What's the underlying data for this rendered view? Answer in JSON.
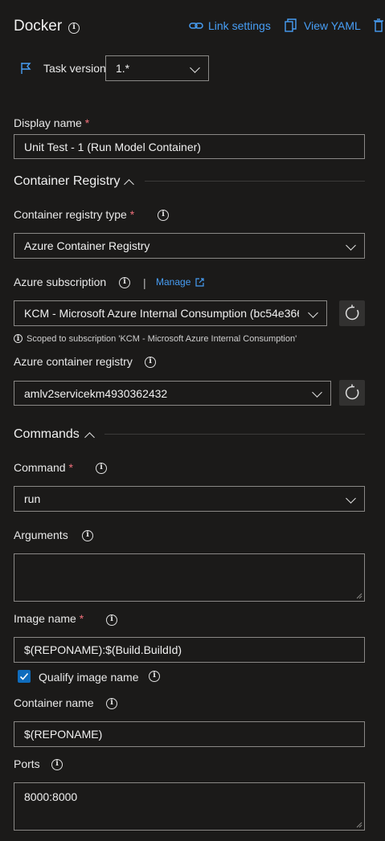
{
  "header": {
    "title": "Docker",
    "link_settings": "Link settings",
    "view_yaml": "View YAML"
  },
  "task_version": {
    "label": "Task version",
    "value": "1.*"
  },
  "display_name": {
    "label": "Display name",
    "required": "*",
    "value": "Unit Test - 1 (Run Model Container)"
  },
  "container_registry_section": {
    "title": "Container Registry"
  },
  "registry_type": {
    "label": "Container registry type",
    "required": "*",
    "value": "Azure Container Registry"
  },
  "azure_subscription": {
    "label": "Azure subscription",
    "separator": "|",
    "manage": "Manage",
    "value": "KCM - Microsoft Azure Internal Consumption (bc54e366",
    "note": "Scoped to subscription 'KCM - Microsoft Azure Internal Consumption'"
  },
  "azure_container_registry": {
    "label": "Azure container registry",
    "value": "amlv2servicekm4930362432"
  },
  "commands_section": {
    "title": "Commands"
  },
  "command": {
    "label": "Command",
    "required": "*",
    "value": "run"
  },
  "arguments": {
    "label": "Arguments",
    "value": ""
  },
  "image_name": {
    "label": "Image name",
    "required": "*",
    "value": "$(REPONAME):$(Build.BuildId)"
  },
  "qualify_image_name": {
    "label": "Qualify image name",
    "checked": true
  },
  "container_name": {
    "label": "Container name",
    "value": "$(REPONAME)"
  },
  "ports": {
    "label": "Ports",
    "value": "8000:8000"
  },
  "colors": {
    "accent": "#479ef5",
    "required": "#f1707b",
    "checkbox": "#0f6cbd",
    "background": "#1b1a19"
  }
}
